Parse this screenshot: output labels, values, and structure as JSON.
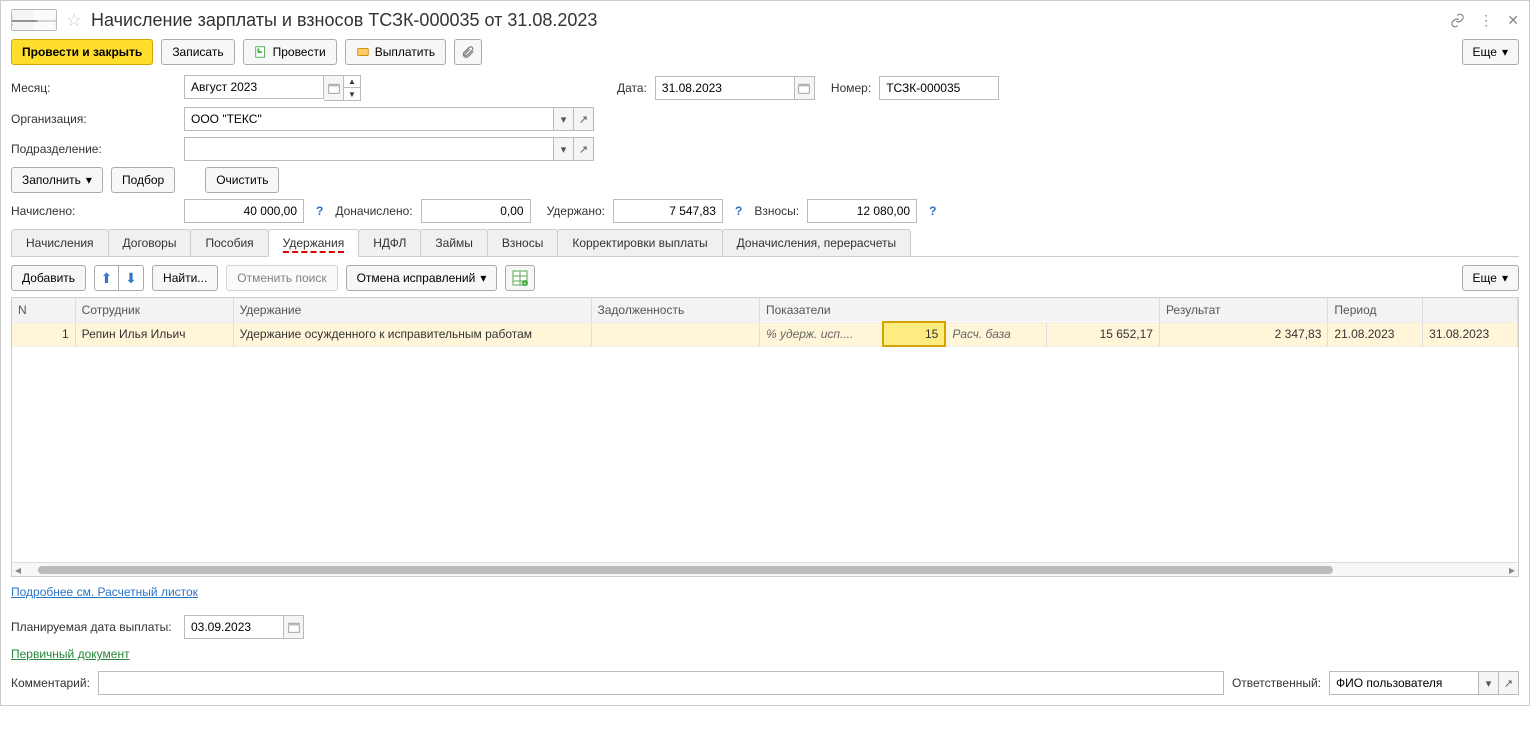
{
  "title": "Начисление зарплаты и взносов ТСЗК-000035 от 31.08.2023",
  "toolbar": {
    "post_close": "Провести и закрыть",
    "save": "Записать",
    "post": "Провести",
    "pay": "Выплатить",
    "more": "Еще"
  },
  "fields": {
    "month_label": "Месяц:",
    "month_value": "Август 2023",
    "date_label": "Дата:",
    "date_value": "31.08.2023",
    "number_label": "Номер:",
    "number_value": "ТСЗК-000035",
    "org_label": "Организация:",
    "org_value": "ООО \"ТЕКС\"",
    "dept_label": "Подразделение:",
    "dept_value": ""
  },
  "actions_row": {
    "fill": "Заполнить",
    "pick": "Подбор",
    "clear": "Очистить"
  },
  "totals": {
    "accrued_label": "Начислено:",
    "accrued_value": "40 000,00",
    "add_accrued_label": "Доначислено:",
    "add_accrued_value": "0,00",
    "withheld_label": "Удержано:",
    "withheld_value": "7 547,83",
    "contrib_label": "Взносы:",
    "contrib_value": "12 080,00"
  },
  "tabs": [
    "Начисления",
    "Договоры",
    "Пособия",
    "Удержания",
    "НДФЛ",
    "Займы",
    "Взносы",
    "Корректировки выплаты",
    "Доначисления, перерасчеты"
  ],
  "active_tab_index": 3,
  "table_toolbar": {
    "add": "Добавить",
    "find": "Найти...",
    "cancel_search": "Отменить поиск",
    "cancel_fix": "Отмена исправлений",
    "more": "Еще"
  },
  "columns": [
    "N",
    "Сотрудник",
    "Удержание",
    "Задолженность",
    "Показатели",
    "",
    "",
    "",
    "Результат",
    "Период",
    ""
  ],
  "row": {
    "n": "1",
    "employee": "Репин Илья Ильич",
    "deduction": "Удержание осужденного к исправительным работам",
    "debt": "",
    "ind1_label": "% удерж. исп....",
    "ind1_val": "15",
    "ind2_label": "Расч. база",
    "ind2_val": "15 652,17",
    "result": "2 347,83",
    "period_from": "21.08.2023",
    "period_to": "31.08.2023"
  },
  "details_link": "Подробнее см. Расчетный листок",
  "payout_date_label": "Планируемая дата выплаты:",
  "payout_date_value": "03.09.2023",
  "primary_doc_link": "Первичный документ",
  "comment_label": "Комментарий:",
  "comment_value": "",
  "resp_label": "Ответственный:",
  "resp_value": "ФИО пользователя"
}
